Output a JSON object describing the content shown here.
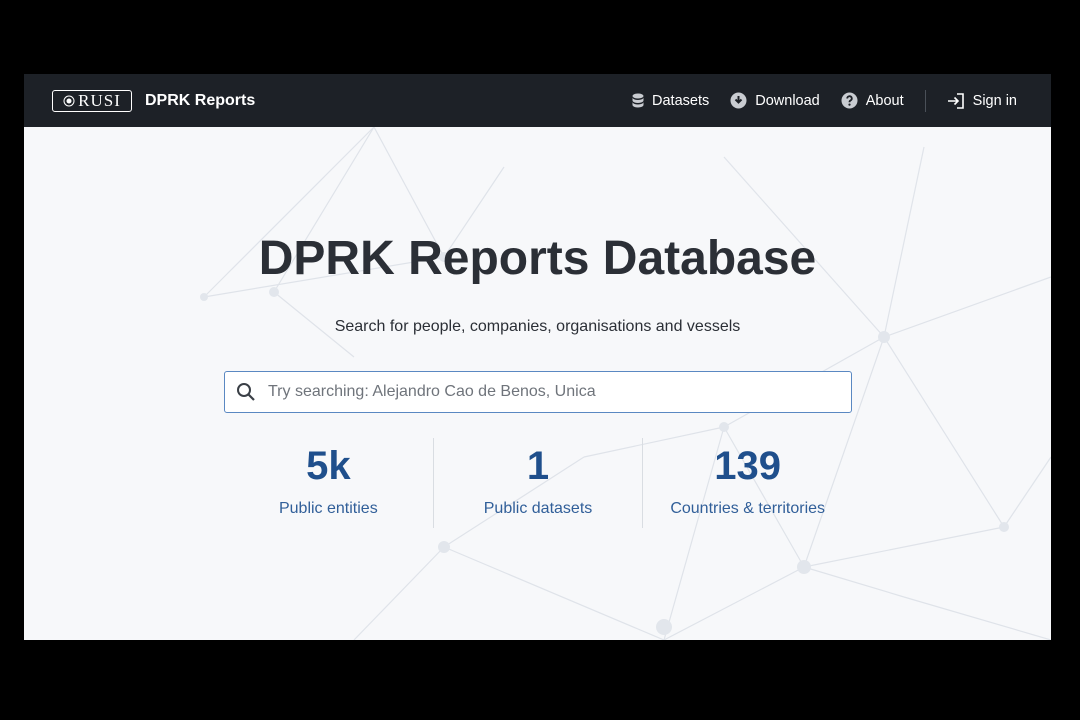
{
  "header": {
    "logo_text": "RUSI",
    "brand_title": "DPRK Reports",
    "nav": [
      {
        "label": "Datasets",
        "icon": "database-icon"
      },
      {
        "label": "Download",
        "icon": "download-icon"
      },
      {
        "label": "About",
        "icon": "help-icon"
      },
      {
        "label": "Sign in",
        "icon": "sign-in-icon"
      }
    ]
  },
  "hero": {
    "title": "DPRK Reports Database",
    "subtitle": "Search for people, companies, organisations and vessels",
    "search_placeholder": "Try searching: Alejandro Cao de Benos, Unica"
  },
  "stats": [
    {
      "value": "5k",
      "label": "Public entities"
    },
    {
      "value": "1",
      "label": "Public datasets"
    },
    {
      "value": "139",
      "label": "Countries & territories"
    }
  ],
  "colors": {
    "navbar": "#1d2127",
    "accent": "#1f4f8c",
    "search_border": "#5a88c2"
  }
}
